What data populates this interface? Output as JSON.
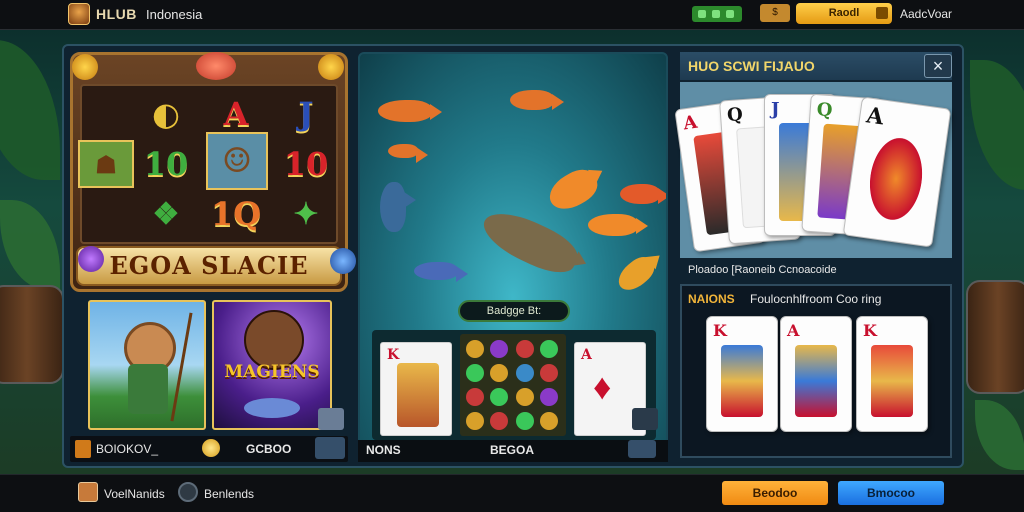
{
  "header": {
    "brand": "HLUB",
    "region": "Indonesia",
    "coin_label": "$",
    "login_label": "Raodl",
    "register_label": "AadcVoar"
  },
  "slot_game": {
    "title": "EGOA SLACIE",
    "reel_symbols": [
      "A",
      "J",
      "10",
      "10",
      "1Q"
    ],
    "thumb_magic_title": "MAGIENS",
    "bottom_label": "BOIOKOV_",
    "bottom_value": "GCBOO"
  },
  "fishing_game": {
    "badge": "Badgge Bt:",
    "bottom_label": "NONS",
    "bottom_value": "BEGOA"
  },
  "card_game": {
    "title": "HUO SCWI FIJAUO",
    "close_label": "×",
    "caption": "Ploadoo [Raoneib Ccnoacoide",
    "sub_title_highlight": "NAIONS",
    "sub_title_rest": "Foulocnhlfroom Coo ring",
    "top_cards": [
      "A",
      "Q",
      "J",
      "Q",
      "A"
    ],
    "bottom_cards": [
      "K",
      "A",
      "K"
    ]
  },
  "footer": {
    "user_label": "VoelNanids",
    "clock_label": "Benlends",
    "primary_button": "Beodoo",
    "secondary_button": "Bmocoo"
  },
  "colors": {
    "accent_gold": "#f2d66a",
    "primary_orange": "#f08a12",
    "secondary_blue": "#1a6fe0",
    "card_red": "#c8102e"
  }
}
